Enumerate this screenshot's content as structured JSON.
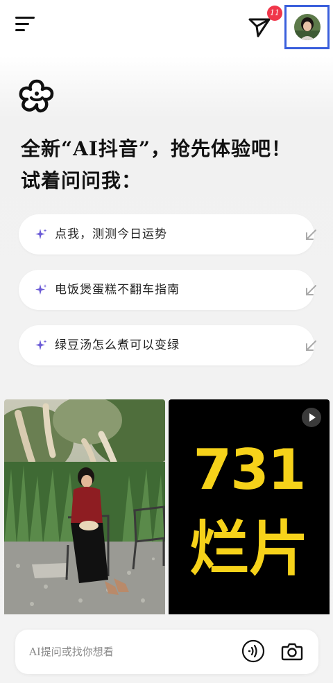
{
  "header": {
    "notification_count": "11",
    "menu_icon": "hamburger-menu-icon",
    "send_icon": "paper-plane-icon",
    "avatar_icon": "user-avatar"
  },
  "logo_icon": "flower-logo-icon",
  "headline": {
    "line1": "全新“AI抖音”，抢先体验吧！",
    "line2": "试着问问我："
  },
  "suggestions": [
    {
      "text": "点我，测测今日运势",
      "icon": "sparkle-icon",
      "action_icon": "arrow-down-left-icon"
    },
    {
      "text": "电饭煲蛋糕不翻车指南",
      "icon": "sparkle-icon",
      "action_icon": "arrow-down-left-icon"
    },
    {
      "text": "绿豆汤怎么煮可以变绿",
      "icon": "sparkle-icon",
      "action_icon": "arrow-down-left-icon"
    }
  ],
  "feed": {
    "video_card": {
      "number": "731",
      "word": "烂片",
      "play_icon": "play-icon"
    }
  },
  "search": {
    "placeholder": "AI提问或找你想看",
    "voice_icon": "voice-wave-icon",
    "camera_icon": "camera-icon"
  },
  "colors": {
    "accent_purple": "#6b5bd6",
    "badge_red": "#f0364a",
    "video_yellow": "#f6d21a",
    "highlight_blue": "#3a5fdc"
  }
}
